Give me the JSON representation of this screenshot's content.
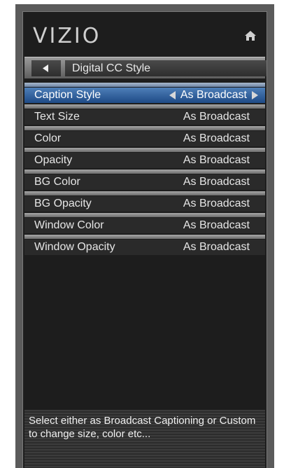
{
  "header": {
    "logo_text": "VIZIO",
    "home_icon": "home-icon"
  },
  "nav": {
    "back_icon": "back-arrow-icon",
    "title": "Digital CC Style"
  },
  "menu": {
    "items": [
      {
        "label": "Caption Style",
        "value": "As Broadcast",
        "selected": true
      },
      {
        "label": "Text Size",
        "value": "As Broadcast"
      },
      {
        "label": "Color",
        "value": "As Broadcast"
      },
      {
        "label": "Opacity",
        "value": "As Broadcast"
      },
      {
        "label": "BG Color",
        "value": "As Broadcast"
      },
      {
        "label": "BG Opacity",
        "value": "As Broadcast"
      },
      {
        "label": "Window Color",
        "value": "As Broadcast"
      },
      {
        "label": "Window Opacity",
        "value": "As Broadcast"
      }
    ]
  },
  "info": {
    "text": "Select either as Broadcast Captioning or Custom to change size, color etc..."
  },
  "colors": {
    "selected_row": "#2f63a2",
    "background": "#1d1d1d",
    "frame": "#5b5b5b"
  }
}
